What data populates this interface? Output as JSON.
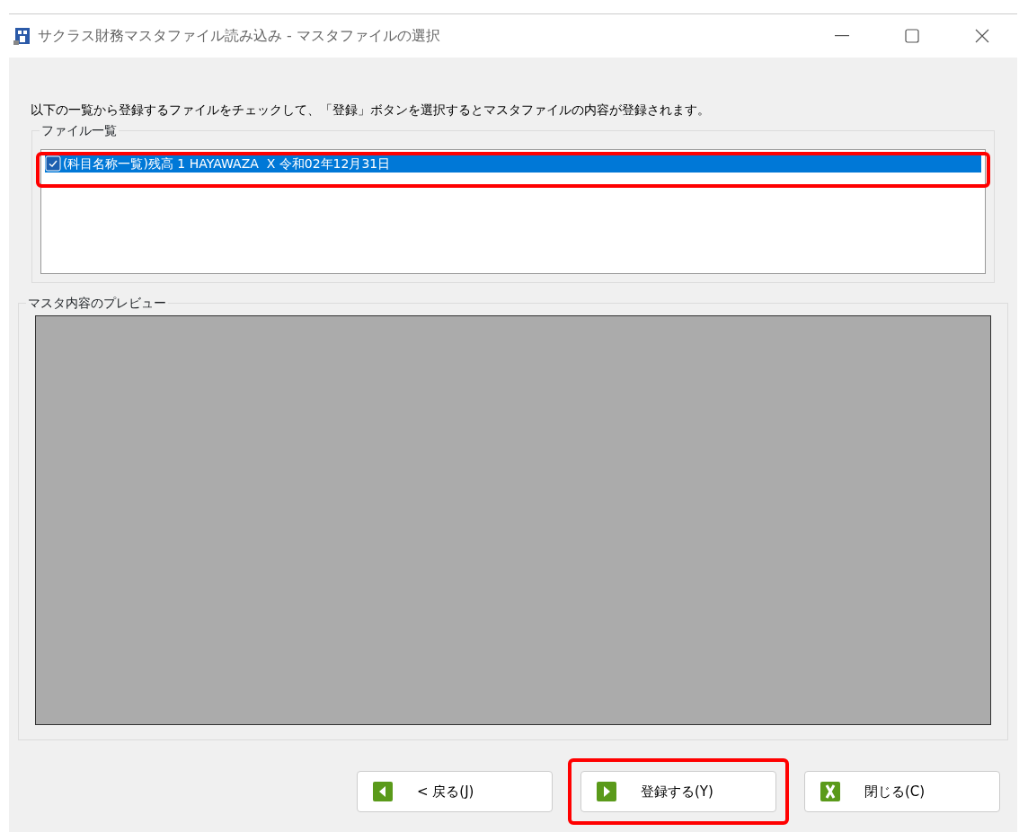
{
  "window": {
    "title": "サクラス財務マスタファイル読み込み - マスタファイルの選択"
  },
  "instruction": "以下の一覧から登録するファイルをチェックして、「登録」ボタンを選択するとマスタファイルの内容が登録されます。",
  "file_list": {
    "label": "ファイル一覧",
    "items": [
      {
        "name": "(科目名称一覧)残高 1 HAYAWAZA  X 令和02年12月31日",
        "checked": true,
        "selected": true,
        "highlighted": true
      }
    ]
  },
  "preview": {
    "label": "マスタ内容のプレビュー"
  },
  "buttons": [
    {
      "kind": "back",
      "label": "< 戻る(J)"
    },
    {
      "kind": "next",
      "label": "登録する(Y)",
      "highlighted": true
    },
    {
      "kind": "close",
      "label": "閉じる(C)"
    }
  ]
}
